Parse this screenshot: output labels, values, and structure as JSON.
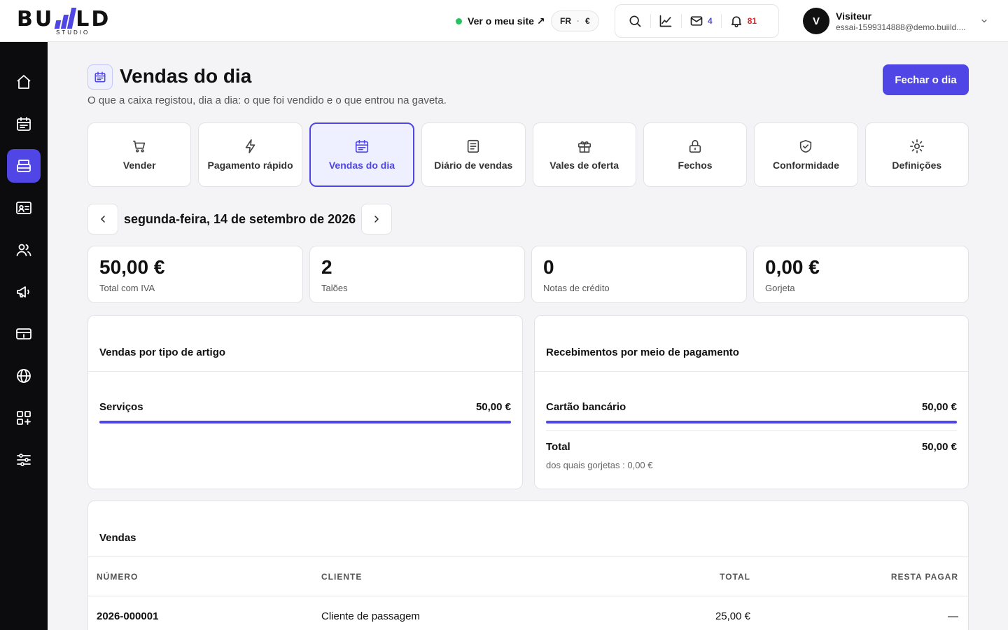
{
  "brand": {
    "logo_left": "BU",
    "logo_right": "LD",
    "logo_sub": "STUDIO"
  },
  "header": {
    "site_link": "Ver o meu site ↗",
    "lang": "FR",
    "currency": "€",
    "mail_count": "4",
    "bell_count": "81",
    "user_initial": "V",
    "user_name": "Visiteur",
    "user_email": "essai-1599314888@demo.buiild...."
  },
  "sidebar": {
    "items": [
      "home-icon",
      "calendar-icon",
      "register-icon",
      "contact-card-icon",
      "users-icon",
      "megaphone-icon",
      "card-icon",
      "globe-icon",
      "apps-icon",
      "sliders-icon"
    ],
    "active_index": 2
  },
  "page": {
    "title": "Vendas do dia",
    "subtitle": "O que a caixa registou, dia a dia: o que foi vendido e o que entrou na gaveta.",
    "primary_button": "Fechar o dia"
  },
  "tabs": [
    {
      "label": "Vender",
      "icon": "cart-icon"
    },
    {
      "label": "Pagamento rápido",
      "icon": "bolt-icon"
    },
    {
      "label": "Vendas do dia",
      "icon": "calendar-icon",
      "active": true
    },
    {
      "label": "Diário de vendas",
      "icon": "journal-icon"
    },
    {
      "label": "Vales de oferta",
      "icon": "gift-icon"
    },
    {
      "label": "Fechos",
      "icon": "lock-icon"
    },
    {
      "label": "Conformidade",
      "icon": "shield-icon"
    },
    {
      "label": "Definições",
      "icon": "sun-icon"
    }
  ],
  "date": {
    "label": "segunda-feira, 14 de setembro de 2026"
  },
  "stats": [
    {
      "value": "50,00 €",
      "label": "Total com IVA"
    },
    {
      "value": "2",
      "label": "Talões"
    },
    {
      "value": "0",
      "label": "Notas de crédito"
    },
    {
      "value": "0,00 €",
      "label": "Gorjeta"
    }
  ],
  "sales_by_type": {
    "title": "Vendas por tipo de artigo",
    "rows": [
      {
        "label": "Serviços",
        "value": "50,00 €",
        "share": 100
      }
    ]
  },
  "payments": {
    "title": "Recebimentos por meio de pagamento",
    "rows": [
      {
        "label": "Cartão bancário",
        "value": "50,00 €",
        "share": 100
      }
    ],
    "total_label": "Total",
    "total_value": "50,00 €",
    "tips_note": "dos quais gorjetas : 0,00 €"
  },
  "sales": {
    "title": "Vendas",
    "columns": [
      "NÚMERO",
      "CLIENTE",
      "TOTAL",
      "RESTA PAGAR"
    ],
    "rows": [
      {
        "number": "2026-000001",
        "client": "Cliente de passagem",
        "total": "25,00 €",
        "due": "—"
      }
    ]
  },
  "colors": {
    "accent": "#4f46e5",
    "online": "#22c55e",
    "alert": "#dc2626",
    "sidebar": "#0c0c0e"
  }
}
